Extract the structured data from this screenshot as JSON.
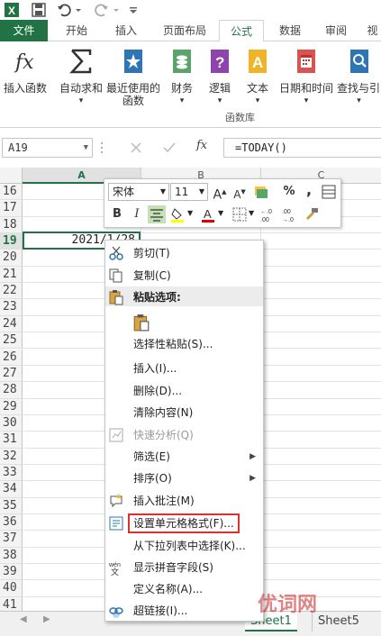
{
  "title_bar": {
    "icons": [
      "excel-app-icon",
      "save-icon",
      "undo-icon",
      "redo-icon",
      "customize-qat-icon"
    ]
  },
  "ribbon_tabs": [
    "文件",
    "开始",
    "插入",
    "页面布局",
    "公式",
    "数据",
    "审阅",
    "视"
  ],
  "active_tab": "公式",
  "ribbon": {
    "buttons": [
      {
        "label": "插入函数",
        "icon": "fx-icon"
      },
      {
        "label": "自动求和",
        "icon": "sigma-icon"
      },
      {
        "label": "最近使用的",
        "label2": "函数",
        "icon": "star-book-icon"
      },
      {
        "label": "财务",
        "icon": "finance-book-icon"
      },
      {
        "label": "逻辑",
        "icon": "question-book-icon"
      },
      {
        "label": "文本",
        "icon": "text-book-icon"
      },
      {
        "label": "日期和时间",
        "icon": "calendar-book-icon"
      },
      {
        "label": "查找与引",
        "icon": "lookup-book-icon"
      }
    ],
    "group_label": "函数库"
  },
  "formula_bar": {
    "name_box": "A19",
    "formula": "=TODAY()",
    "fx_label": "fx"
  },
  "columns": [
    "A",
    "B",
    "C"
  ],
  "row_numbers": [
    "16",
    "17",
    "18",
    "19",
    "20",
    "21",
    "22",
    "23",
    "24",
    "25",
    "26",
    "27",
    "28",
    "29",
    "30",
    "31",
    "32",
    "33",
    "34",
    "35",
    "36",
    "37",
    "38",
    "39",
    "40",
    "41"
  ],
  "selected_cell_value": "2021/1/28",
  "mini_toolbar": {
    "font_name": "宋体",
    "font_size": "11",
    "bold": "B",
    "italic": "I",
    "percent": "%",
    "comma": ","
  },
  "context_menu": {
    "items": [
      {
        "label": "剪切(T)",
        "icon": "scissors-icon",
        "enabled": true
      },
      {
        "label": "复制(C)",
        "icon": "copy-icon",
        "enabled": true
      },
      {
        "label": "粘贴选项:",
        "icon": "paste-icon",
        "enabled": true,
        "header": true
      },
      {
        "label": "",
        "icon": "paste-clipboard-icon",
        "enabled": true
      },
      {
        "label": "选择性粘贴(S)...",
        "icon": "",
        "enabled": true
      },
      {
        "label": "插入(I)...",
        "icon": "",
        "enabled": true
      },
      {
        "label": "删除(D)...",
        "icon": "",
        "enabled": true
      },
      {
        "label": "清除内容(N)",
        "icon": "",
        "enabled": true
      },
      {
        "label": "快速分析(Q)",
        "icon": "quick-analysis-icon",
        "enabled": false
      },
      {
        "label": "筛选(E)",
        "icon": "",
        "enabled": true,
        "submenu": true
      },
      {
        "label": "排序(O)",
        "icon": "",
        "enabled": true,
        "submenu": true
      },
      {
        "label": "插入批注(M)",
        "icon": "insert-comment-icon",
        "enabled": true
      },
      {
        "label": "设置单元格格式(F)...",
        "icon": "format-cells-icon",
        "enabled": true,
        "highlighted": true
      },
      {
        "label": "从下拉列表中选择(K)...",
        "icon": "",
        "enabled": true
      },
      {
        "label": "显示拼音字段(S)",
        "icon": "phonetic-icon",
        "enabled": true
      },
      {
        "label": "定义名称(A)...",
        "icon": "",
        "enabled": true
      },
      {
        "label": "超链接(I)...",
        "icon": "hyperlink-icon",
        "enabled": true
      }
    ],
    "phonetic_icon_text": "wén"
  },
  "sheet_tabs": [
    "Sheet1",
    "Sheet5"
  ],
  "active_sheet": "Sheet1",
  "watermark": "优词网",
  "colors": {
    "excel_green": "#217346",
    "highlight_red": "#e0302a"
  }
}
